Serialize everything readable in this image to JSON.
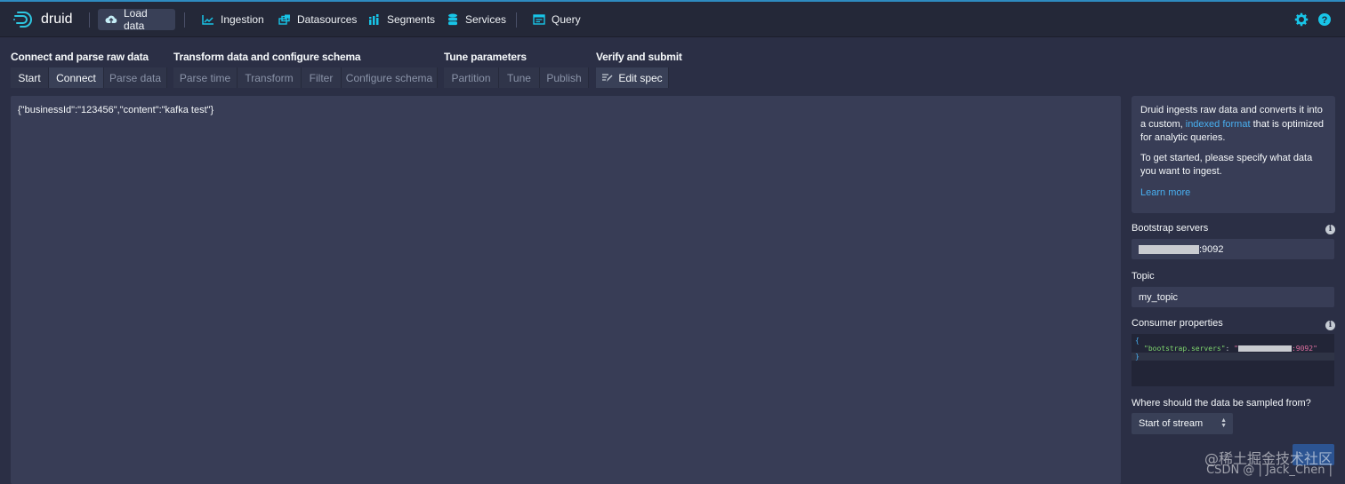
{
  "app": {
    "logo_text": "druid"
  },
  "nav": {
    "items": [
      {
        "label": "Load data",
        "icon": "cloud-upload-icon"
      },
      {
        "label": "Ingestion",
        "icon": "chart-icon"
      },
      {
        "label": "Datasources",
        "icon": "datasources-icon"
      },
      {
        "label": "Segments",
        "icon": "segments-icon"
      },
      {
        "label": "Services",
        "icon": "database-icon"
      },
      {
        "label": "Query",
        "icon": "query-icon"
      }
    ],
    "right_icons": [
      "gear-icon",
      "help-icon"
    ]
  },
  "steps": {
    "groups": [
      "Connect and parse raw data",
      "Transform data and configure schema",
      "Tune parameters",
      "Verify and submit"
    ],
    "items": [
      "Start",
      "Connect",
      "Parse data",
      "Parse time",
      "Transform",
      "Filter",
      "Configure schema",
      "Partition",
      "Tune",
      "Publish",
      "Edit spec"
    ]
  },
  "main": {
    "sample_text": "{\"businessId\":\"123456\",\"content\":\"kafka test\"}"
  },
  "info": {
    "p1_before": "Druid ingests raw data and converts it into a custom, ",
    "p1_link": "indexed format",
    "p1_after": " that is optimized for analytic queries.",
    "p2": "To get started, please specify what data you want to ingest.",
    "learn_more": "Learn more"
  },
  "form": {
    "bootstrap_label": "Bootstrap servers",
    "bootstrap_value_suffix": ":9092",
    "topic_label": "Topic",
    "topic_value": "my_topic",
    "consumer_label": "Consumer properties",
    "consumer_code": {
      "open": "{",
      "key": "\"bootstrap.servers\"",
      "colon": ": ",
      "value_prefix": "\"",
      "value_suffix": ":9092\"",
      "close": "}"
    },
    "sample_label": "Where should the data be sampled from?",
    "sample_value": "Start of stream"
  },
  "watermark": {
    "line1": "@稀土掘金技术社区",
    "line2": "CSDN @ | Jack_Chen |"
  },
  "colors": {
    "background": "#2b2f45",
    "navbar": "#242838",
    "panel": "#383d56",
    "accent": "#2e8bc0",
    "link": "#48aff0",
    "icon": "#18c5e8"
  }
}
